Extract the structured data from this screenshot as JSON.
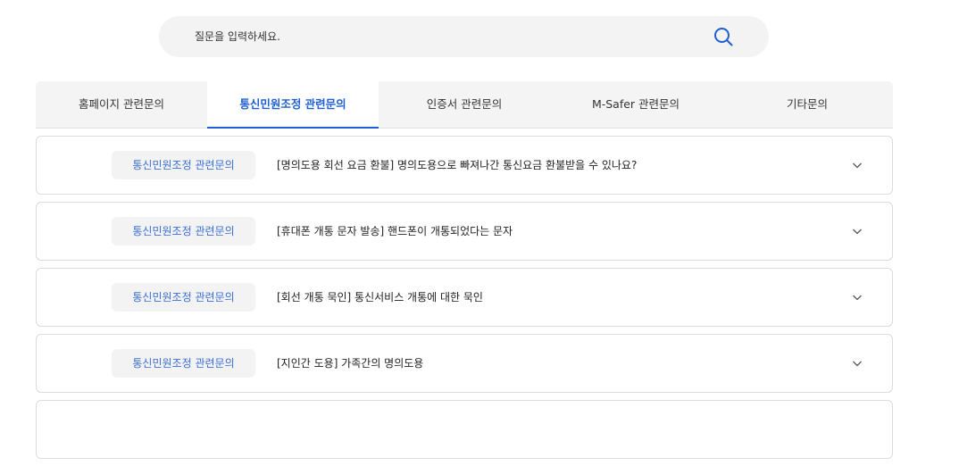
{
  "search": {
    "placeholder": "질문을 입력하세요."
  },
  "tabs": [
    {
      "label": "홈페이지 관련문의",
      "active": false
    },
    {
      "label": "통신민원조정 관련문의",
      "active": true
    },
    {
      "label": "인증서 관련문의",
      "active": false
    },
    {
      "label": "M-Safer 관련문의",
      "active": false
    },
    {
      "label": "기타문의",
      "active": false
    }
  ],
  "faq": [
    {
      "category": "통신민원조정 관련문의",
      "question": "[명의도용 회선 요금 환불] 명의도용으로 빠져나간 통신요금 환불받을 수 있나요?"
    },
    {
      "category": "통신민원조정 관련문의",
      "question": "[휴대폰 개통 문자 발송] 핸드폰이 개통되었다는 문자"
    },
    {
      "category": "통신민원조정 관련문의",
      "question": "[회선 개통 묵인] 통신서비스 개통에 대한 묵인"
    },
    {
      "category": "통신민원조정 관련문의",
      "question": "[지인간 도용] 가족간의 명의도용"
    },
    {
      "category": "",
      "question": ""
    }
  ],
  "colors": {
    "accent": "#1f5fd1",
    "badge_text": "#3a6fd8",
    "search_bg": "#f3f3f3",
    "tab_bg": "#f4f4f4"
  },
  "icons": {
    "search": "search-icon",
    "expand": "chevron-down-icon"
  }
}
